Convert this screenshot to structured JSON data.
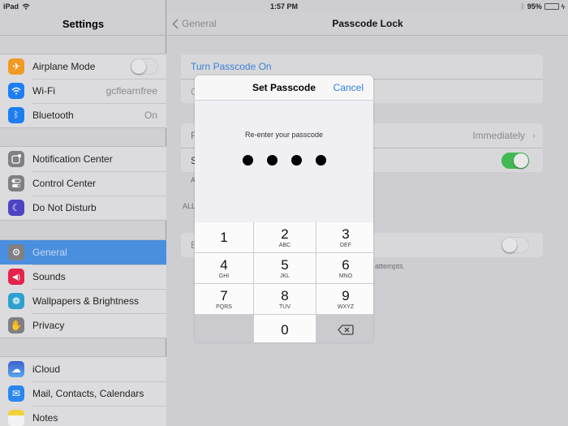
{
  "status_bar": {
    "device": "iPad",
    "time": "1:57 PM",
    "battery_percent": "95%",
    "battery_level": 0.95,
    "battery_color": "#4cd964",
    "icons": [
      "wifi-icon",
      "bluetooth-icon",
      "battery-icon",
      "charging-icon"
    ]
  },
  "sidebar": {
    "title": "Settings",
    "groups": [
      [
        {
          "label": "Airplane Mode",
          "icon": "airplane-icon",
          "icon_color": "#f19a23",
          "toggle": false
        },
        {
          "label": "Wi-Fi",
          "icon": "wifi-icon",
          "icon_color": "#1e7df0",
          "value": "gcflearnfree"
        },
        {
          "label": "Bluetooth",
          "icon": "bluetooth-icon",
          "icon_color": "#1e7df0",
          "value": "On"
        }
      ],
      [
        {
          "label": "Notification Center",
          "icon": "notification-center-icon",
          "icon_color": "#7f7f84"
        },
        {
          "label": "Control Center",
          "icon": "control-center-icon",
          "icon_color": "#7f7f84"
        },
        {
          "label": "Do Not Disturb",
          "icon": "moon-icon",
          "icon_color": "#4d43c3"
        }
      ],
      [
        {
          "label": "General",
          "icon": "gear-icon",
          "icon_color": "#7f7f84",
          "selected": true
        },
        {
          "label": "Sounds",
          "icon": "speaker-icon",
          "icon_color": "#e5234a"
        },
        {
          "label": "Wallpapers & Brightness",
          "icon": "flower-icon",
          "icon_color": "#2ea0cf"
        },
        {
          "label": "Privacy",
          "icon": "hand-icon",
          "icon_color": "#7f7f84"
        }
      ],
      [
        {
          "label": "iCloud",
          "icon": "cloud-icon",
          "icon_color": "#4a6fd8"
        },
        {
          "label": "Mail, Contacts, Calendars",
          "icon": "mail-icon",
          "icon_color": "#2a86ee"
        },
        {
          "label": "Notes",
          "icon": "notes-icon",
          "icon_color": "#f4d13c"
        }
      ]
    ]
  },
  "detail": {
    "back_label": "General",
    "title": "Passcode Lock",
    "rows": {
      "turn_on": "Turn Passcode On",
      "change": "Change Passcode",
      "require": "Require Passcode",
      "require_value": "Immediately",
      "simple": "Simple Passcode",
      "simple_on": true,
      "note1": "A",
      "allow_header": "ALL",
      "erase": "Erase Data",
      "erase_on": false,
      "erase_note": "attempts."
    }
  },
  "modal": {
    "title": "Set Passcode",
    "cancel_label": "Cancel",
    "prompt": "Re-enter your passcode",
    "entered_digits": 4,
    "keys": [
      {
        "num": "1",
        "letters": ""
      },
      {
        "num": "2",
        "letters": "ABC"
      },
      {
        "num": "3",
        "letters": "DEF"
      },
      {
        "num": "4",
        "letters": "GHI"
      },
      {
        "num": "5",
        "letters": "JKL"
      },
      {
        "num": "6",
        "letters": "MNO"
      },
      {
        "num": "7",
        "letters": "PQRS"
      },
      {
        "num": "8",
        "letters": "TUV"
      },
      {
        "num": "9",
        "letters": "WXYZ"
      },
      {
        "num": "0",
        "letters": ""
      }
    ],
    "delete_icon": "backspace-icon"
  }
}
